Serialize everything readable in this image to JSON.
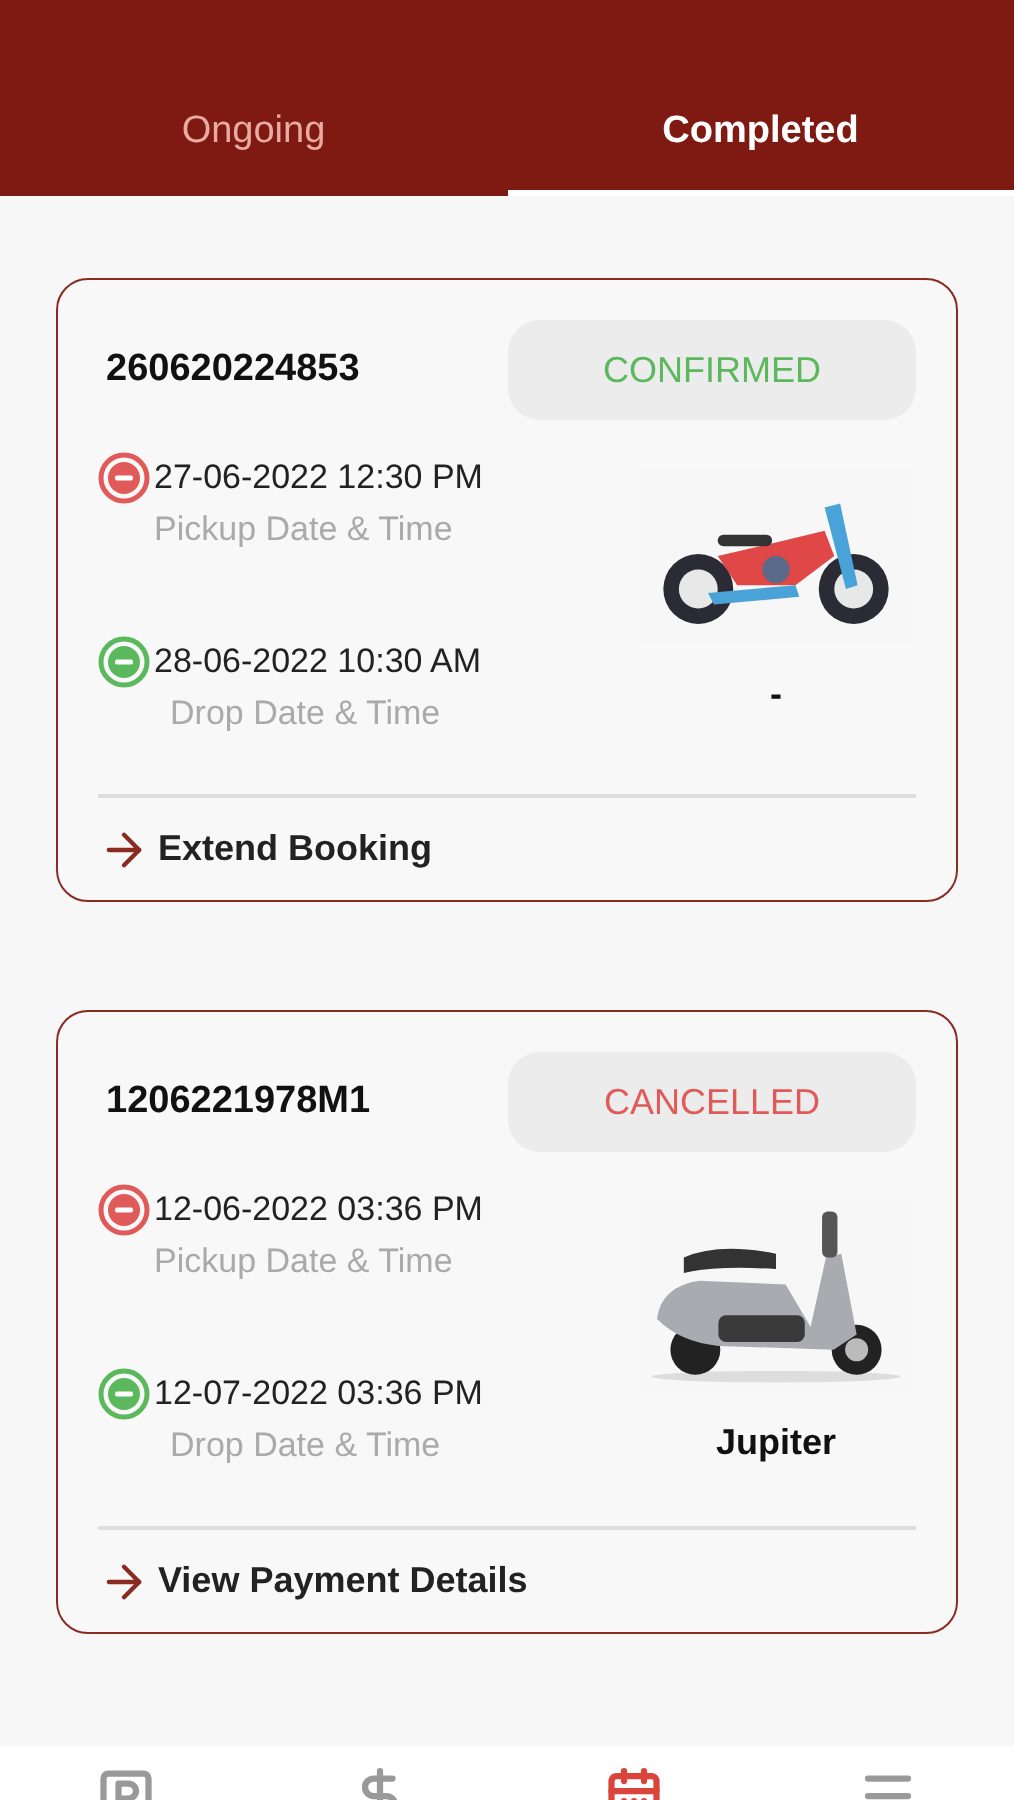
{
  "tabs": [
    {
      "label": "Ongoing",
      "selected": false
    },
    {
      "label": "Completed",
      "selected": true
    }
  ],
  "bookings": [
    {
      "booking_id": "260620224853",
      "status": {
        "label": "CONFIRMED",
        "color": "#5cb85c"
      },
      "pickup": {
        "datetime": "27-06-2022 12:30 PM",
        "label": "Pickup Date & Time"
      },
      "drop": {
        "datetime": "28-06-2022 10:30 AM",
        "label": "Drop Date & Time"
      },
      "vehicle_name": "-",
      "action": "Extend Booking"
    },
    {
      "booking_id": "1206221978M1",
      "status": {
        "label": "CANCELLED",
        "color": "#e05a5a"
      },
      "pickup": {
        "datetime": "12-06-2022 03:36 PM",
        "label": "Pickup Date & Time"
      },
      "drop": {
        "datetime": "12-07-2022 03:36 PM",
        "label": "Drop Date & Time"
      },
      "vehicle_name": "Jupiter",
      "action": "View Payment Details"
    }
  ],
  "bottom_nav": [
    {
      "kind": "parking",
      "selected": false
    },
    {
      "kind": "money",
      "selected": false
    },
    {
      "kind": "calendar",
      "selected": true
    },
    {
      "kind": "menu",
      "selected": false
    }
  ]
}
